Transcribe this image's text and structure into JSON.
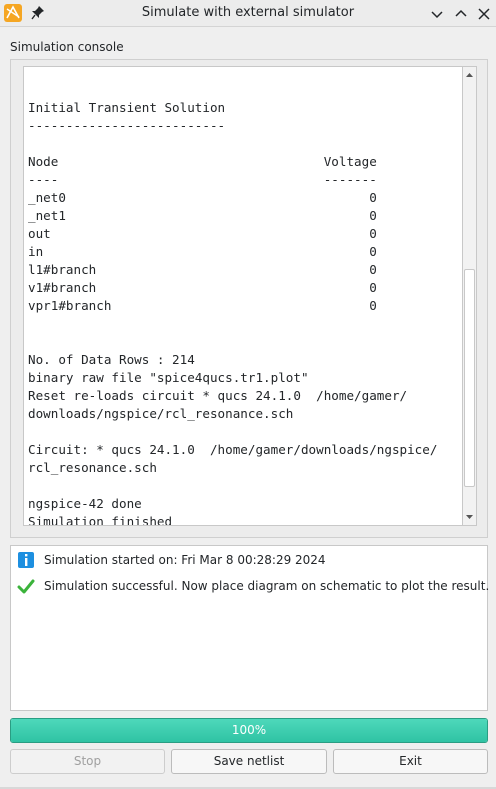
{
  "window": {
    "title": "Simulate with external simulator",
    "icons": {
      "app": "qucs-app-icon",
      "pin": "pin-icon",
      "minimize": "chevron-down-icon",
      "maximize": "chevron-up-icon",
      "close": "close-icon"
    }
  },
  "console": {
    "label": "Simulation console",
    "lines": [
      "",
      "Initial Transient Solution",
      "--------------------------",
      "",
      "Node                                   Voltage",
      "----                                   -------",
      "_net0                                        0",
      "_net1                                        0",
      "out                                          0",
      "in                                           0",
      "l1#branch                                    0",
      "v1#branch                                    0",
      "vpr1#branch                                  0",
      "",
      "",
      "No. of Data Rows : 214",
      "binary raw file \"spice4qucs.tr1.plot\"",
      "Reset re-loads circuit * qucs 24.1.0  /home/gamer/",
      "downloads/ngspice/rcl_resonance.sch",
      "",
      "Circuit: * qucs 24.1.0  /home/gamer/downloads/ngspice/",
      "rcl_resonance.sch",
      "",
      "ngspice-42 done",
      "Simulation finished"
    ]
  },
  "messages": [
    {
      "icon": "info-icon",
      "text": "Simulation started on: Fri Mar 8 00:28:29 2024"
    },
    {
      "icon": "checkmark-icon",
      "text": "Simulation successful. Now place diagram on schematic to plot the result."
    }
  ],
  "progress": {
    "label": "100%",
    "value": 1.0
  },
  "buttons": {
    "stop": "Stop",
    "save_netlist": "Save netlist",
    "exit": "Exit"
  },
  "colors": {
    "progress_fill": "#2fc3a4",
    "info_icon": "#1d8fe0",
    "check_icon": "#3bb33b",
    "app_icon": "#f5a623"
  }
}
